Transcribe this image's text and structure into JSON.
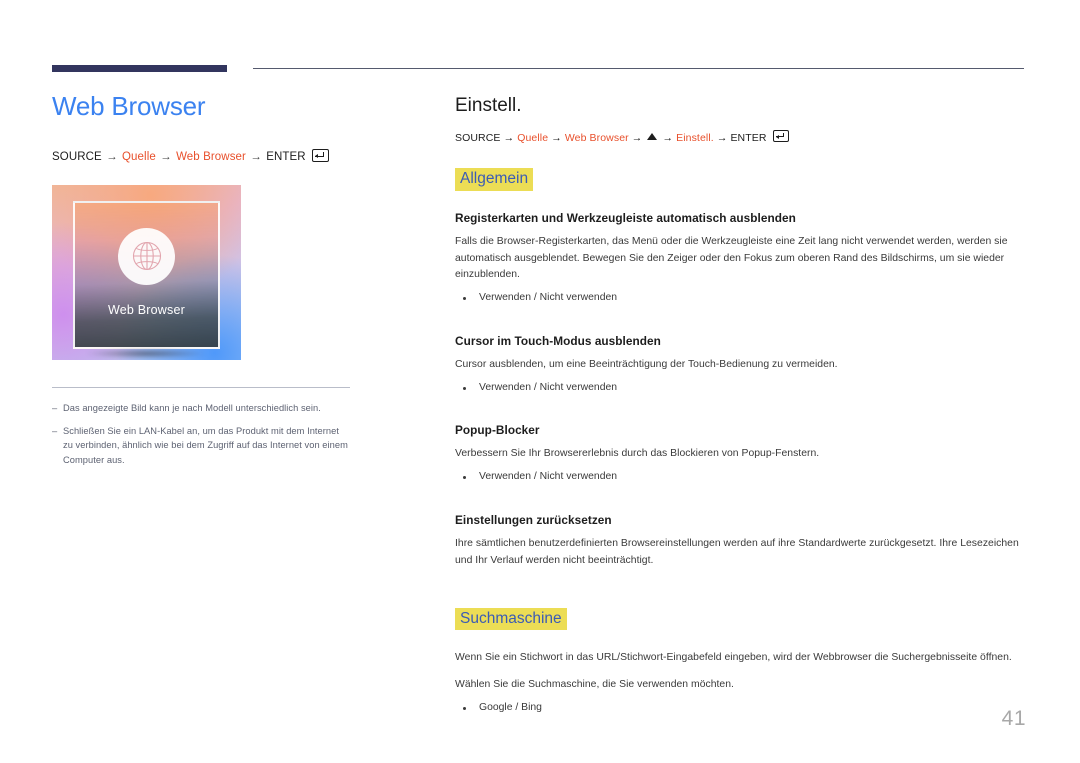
{
  "decor": {
    "bar_color": "#32355e",
    "line_color": "#555a6e",
    "accent_blue": "#3b82f0",
    "accent_orange": "#e8502c",
    "highlight_yellow": "#ecdd55",
    "highlight_text": "#3b5bb5"
  },
  "left": {
    "title": "Web Browser",
    "breadcrumb": {
      "source": "SOURCE",
      "arrow": "→",
      "step1": "Quelle",
      "step2": "Web Browser",
      "enter": "ENTER",
      "enter_icon": "enter-key-icon"
    },
    "thumbnail": {
      "label": "Web Browser",
      "icon": "globe-icon"
    },
    "notes": [
      {
        "dash": "–",
        "text": "Das angezeigte Bild kann je nach Modell unterschiedlich sein."
      },
      {
        "dash": "–",
        "text": "Schließen Sie ein LAN-Kabel an, um das Produkt mit dem Internet zu verbinden, ähnlich wie bei dem Zugriff auf das Internet von einem Computer aus."
      }
    ]
  },
  "right": {
    "section_title": "Einstell.",
    "breadcrumb": {
      "source": "SOURCE",
      "arrow": "→",
      "step1": "Quelle",
      "step2": "Web Browser",
      "step3_icon": "triangle-up-icon",
      "step4": "Einstell.",
      "enter": "ENTER",
      "enter_icon": "enter-key-icon"
    },
    "groups": [
      {
        "heading": "Allgemein",
        "items": [
          {
            "head": "Registerkarten und Werkzeugleiste automatisch ausblenden",
            "body": "Falls die Browser-Registerkarten, das Menü oder die Werkzeugleiste eine Zeit lang nicht verwendet werden, werden sie automatisch ausgeblendet. Bewegen Sie den Zeiger oder den Fokus zum oberen Rand des Bildschirms, um sie wieder einzublenden.",
            "options": [
              "Verwenden / Nicht verwenden"
            ]
          },
          {
            "head": "Cursor im Touch-Modus ausblenden",
            "body": "Cursor ausblenden, um eine Beeinträchtigung der Touch-Bedienung zu vermeiden.",
            "options": [
              "Verwenden / Nicht verwenden"
            ]
          },
          {
            "head": "Popup-Blocker",
            "body": "Verbessern Sie Ihr Browsererlebnis durch das Blockieren von Popup-Fenstern.",
            "options": [
              "Verwenden / Nicht verwenden"
            ]
          },
          {
            "head": "Einstellungen zurücksetzen",
            "body": "Ihre sämtlichen benutzerdefinierten Browsereinstellungen werden auf ihre Standardwerte zurückgesetzt. Ihre Lesezeichen und Ihr Verlauf werden nicht beeinträchtigt.",
            "options": []
          }
        ]
      },
      {
        "heading": "Suchmaschine",
        "body1": "Wenn Sie ein Stichwort in das URL/Stichwort-Eingabefeld eingeben, wird der Webbrowser die Suchergebnisseite öffnen.",
        "body2": "Wählen Sie die Suchmaschine, die Sie verwenden möchten.",
        "options": [
          "Google / Bing"
        ]
      }
    ]
  },
  "footer": {
    "page_number": "41"
  }
}
